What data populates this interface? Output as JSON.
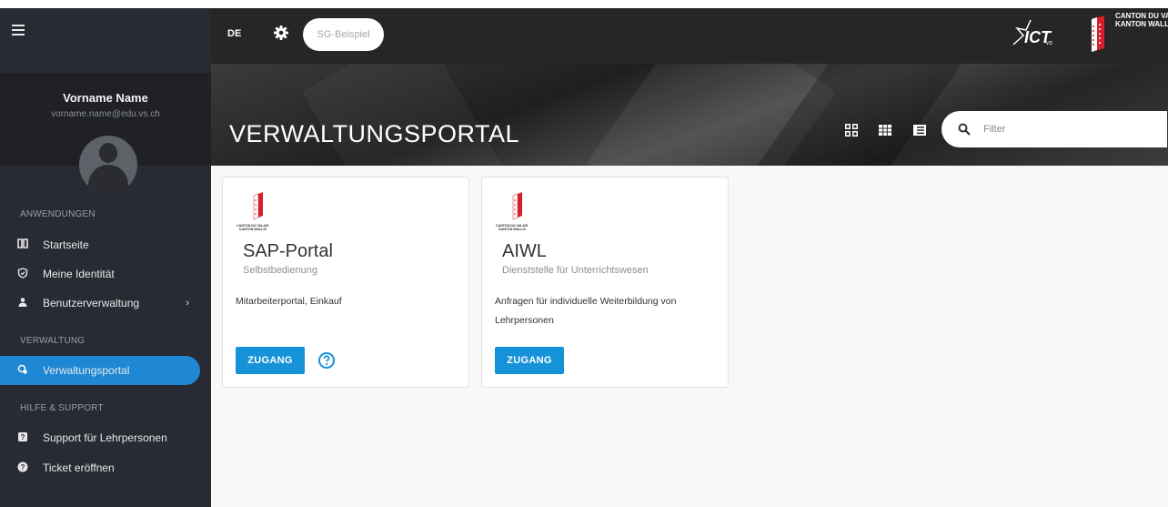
{
  "topbar": {
    "lang": "DE",
    "sg_label": "SG-Beispiel",
    "canton_line1": "CANTON DU VALA",
    "canton_line2": "KANTON WALLIS"
  },
  "profile": {
    "name": "Vorname Name",
    "email": "vorname.name@edu.vs.ch"
  },
  "sidebar": {
    "sections": [
      {
        "title": "ANWENDUNGEN"
      },
      {
        "title": "VERWALTUNG"
      },
      {
        "title": "HILFE & SUPPORT"
      }
    ],
    "items": [
      {
        "label": "Startseite",
        "icon": "book-icon"
      },
      {
        "label": "Meine Identität",
        "icon": "shield-check-icon"
      },
      {
        "label": "Benutzerverwaltung",
        "icon": "users-icon",
        "chevron": "›"
      },
      {
        "label": "Verwaltungsportal",
        "icon": "portal-icon",
        "active": true
      },
      {
        "label": "Support für Lehrpersonen",
        "icon": "support-icon"
      },
      {
        "label": "Ticket eröffnen",
        "icon": "help-circle-icon"
      }
    ]
  },
  "hero": {
    "title": "VERWALTUNGSPORTAL",
    "search_placeholder": "Filter"
  },
  "cards": [
    {
      "logo_text_1": "CANTON DU VALAIS",
      "logo_text_2": "KANTON WALLIS",
      "title": "SAP-Portal",
      "subtitle": "Selbstbedienung",
      "description": "Mitarbeiterportal, Einkauf",
      "button": "ZUGANG",
      "has_help": true
    },
    {
      "logo_text_1": "CANTON DU VALAIS",
      "logo_text_2": "KANTON WALLIS",
      "title": "AIWL",
      "subtitle": "Dienststelle für Unterrichtswesen",
      "description": "Anfragen für individuelle Weiterbildung von Lehrpersonen",
      "button": "ZUGANG",
      "has_help": false
    }
  ],
  "colors": {
    "accent": "#1592d8",
    "sidebar_bg": "#282b33",
    "topbar_bg": "#262626"
  }
}
